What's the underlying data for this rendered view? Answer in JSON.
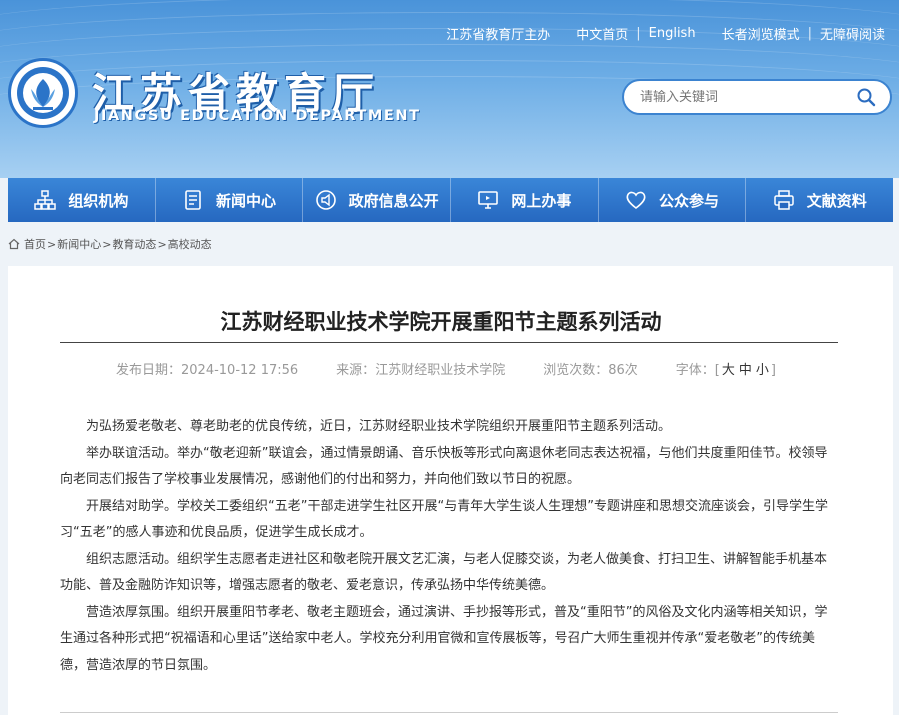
{
  "toplinks": {
    "host": "江苏省教育厅主办",
    "home_cn": "中文首页",
    "english": "English",
    "elder_mode": "长者浏览模式",
    "accessible": "无障碍阅读"
  },
  "brand": {
    "name_cn": "江苏省教育厅",
    "name_en": "JIANGSU EDUCATION DEPARTMENT"
  },
  "search": {
    "placeholder": "请输入关键词"
  },
  "nav": [
    {
      "label": "组织机构",
      "icon": "org-chart-icon"
    },
    {
      "label": "新闻中心",
      "icon": "document-icon"
    },
    {
      "label": "政府信息公开",
      "icon": "megaphone-icon"
    },
    {
      "label": "网上办事",
      "icon": "monitor-icon"
    },
    {
      "label": "公众参与",
      "icon": "heart-icon"
    },
    {
      "label": "文献资料",
      "icon": "printer-icon"
    }
  ],
  "breadcrumb": [
    "首页",
    "新闻中心",
    "教育动态",
    "高校动态"
  ],
  "breadcrumb_sep": ">",
  "article": {
    "title": "江苏财经职业技术学院开展重阳节主题系列活动",
    "published_label": "发布日期：",
    "published": "2024-10-12 17:56",
    "source_label": "来源：",
    "source": "江苏财经职业技术学院",
    "views_label": "浏览次数：",
    "views": "86次",
    "fontsize_label": "字体：",
    "fontsize_open": "[",
    "fontsize_large": "大",
    "fontsize_medium": "中",
    "fontsize_small": "小",
    "fontsize_close": "]",
    "paragraphs": [
      "为弘扬爱老敬老、尊老助老的优良传统，近日，江苏财经职业技术学院组织开展重阳节主题系列活动。",
      "举办联谊活动。举办“敬老迎新”联谊会，通过情景朗诵、音乐快板等形式向离退休老同志表达祝福，与他们共度重阳佳节。校领导向老同志们报告了学校事业发展情况，感谢他们的付出和努力，并向他们致以节日的祝愿。",
      "开展结对助学。学校关工委组织“五老”干部走进学生社区开展“与青年大学生谈人生理想”专题讲座和思想交流座谈会，引导学生学习“五老”的感人事迹和优良品质，促进学生成长成才。",
      "组织志愿活动。组织学生志愿者走进社区和敬老院开展文艺汇演，与老人促膝交谈，为老人做美食、打扫卫生、讲解智能手机基本功能、普及金融防诈知识等，增强志愿者的敬老、爱老意识，传承弘扬中华传统美德。",
      "营造浓厚氛围。组织开展重阳节孝老、敬老主题班会，通过演讲、手抄报等形式，普及“重阳节”的风俗及文化内涵等相关知识，学生通过各种形式把“祝福语和心里话”送给家中老人。学校充分利用官微和宣传展板等，号召广大师生重视并传承“爱老敬老”的传统美德，营造浓厚的节日氛围。"
    ]
  },
  "colors": {
    "header_top": "#4a93d9",
    "nav": "#2668c0",
    "page_bg": "#eef3f8"
  }
}
